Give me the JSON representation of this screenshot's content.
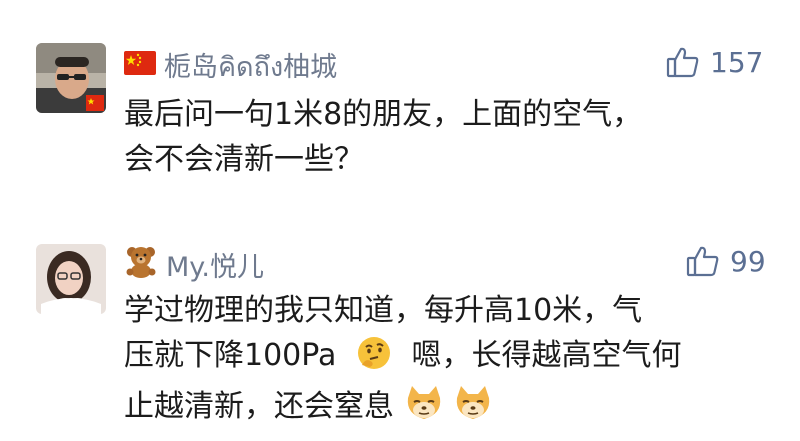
{
  "comments": [
    {
      "author": "栀岛คิดถึง柚城",
      "author_emoji": "china-flag",
      "likes": "157",
      "lines": [
        "最后问一句1米8的朋友，上面的空气，",
        "会不会清新一些？"
      ]
    },
    {
      "author": "My.悦儿",
      "author_emoji": "teddy-bear",
      "likes": "99",
      "line1": "学过物理的我只知道，每升高10米，气",
      "line2a": "压就下降100Pa",
      "line2b": "嗯，长得越高空气何",
      "line3": "止越清新，还会窒息",
      "inline_emojis": [
        "thinking-face-emoji",
        "doge-emoji",
        "doge-emoji"
      ]
    }
  ],
  "colors": {
    "author": "#6f7a8e",
    "likes": "#5b6f93",
    "text": "#1c1c1c"
  }
}
